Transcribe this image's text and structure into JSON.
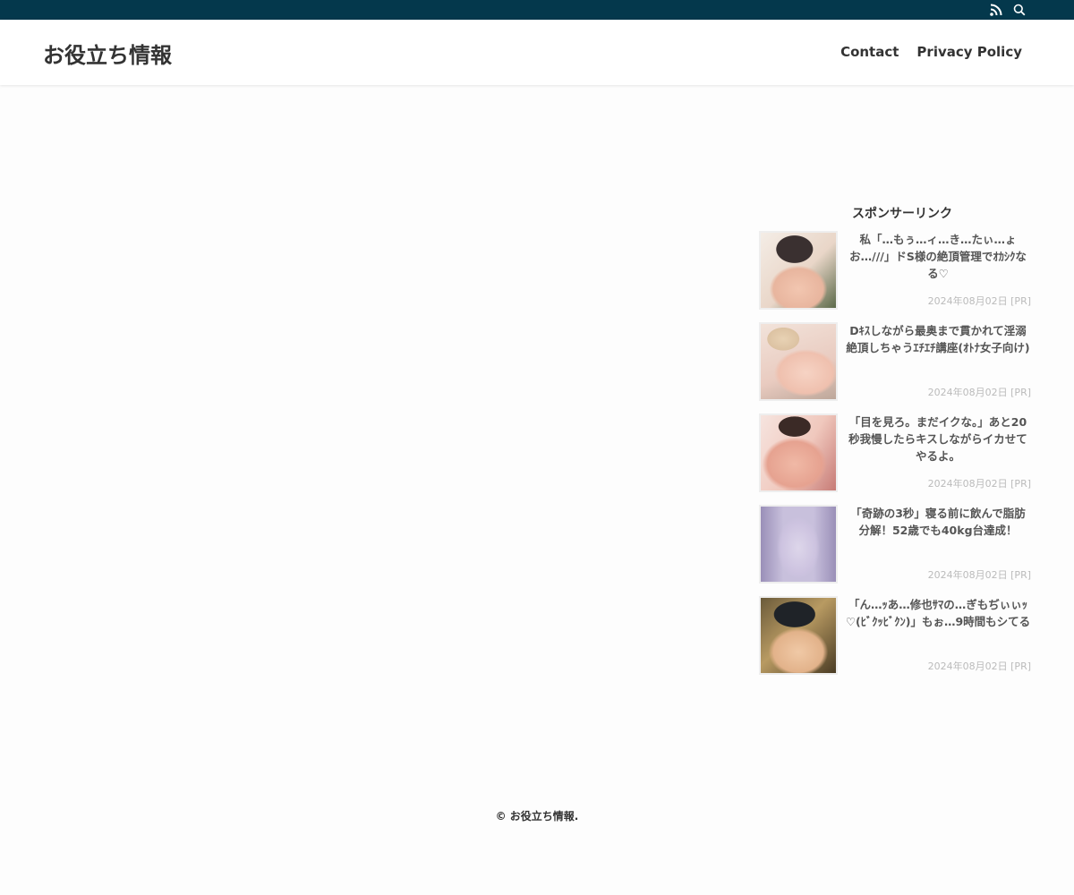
{
  "topbar": {
    "icons": [
      "rss-icon",
      "search-icon"
    ],
    "color": "#04384c"
  },
  "header": {
    "site_title": "お役立ち情報",
    "nav": [
      "Contact",
      "Privacy Policy"
    ]
  },
  "widget": {
    "title": "スポンサーリンク",
    "items": [
      {
        "title": "私「…もぅ…ィ…き…たぃ…ょお…///」ドS様の絶頂管理でｵｶｼｸなる♡",
        "date": "2024年08月02日",
        "badge": "[PR]"
      },
      {
        "title": "Dｷｽしながら最奥まで貫かれて淫溺絶頂しちゃうｴﾁｴﾁ講座(ｵﾄﾅ女子向け)",
        "date": "2024年08月02日",
        "badge": "[PR]"
      },
      {
        "title": "「目を見ろ。まだイクな。」あと20秒我慢したらキスしながらイカせてやるよ。",
        "date": "2024年08月02日",
        "badge": "[PR]"
      },
      {
        "title": "「奇跡の3秒」寝る前に飲んで脂肪分解！52歳でも40kg台達成！",
        "date": "2024年08月02日",
        "badge": "[PR]"
      },
      {
        "title": "「ん…ｯあ…修也ｻﾏの…ぎもぢぃぃｯ♡(ﾋﾞｸｯﾋﾞｸﾝ)」もぉ…9時間もシてる",
        "date": "2024年08月02日",
        "badge": "[PR]"
      }
    ]
  },
  "footer": {
    "text": "© お役立ち情報."
  }
}
